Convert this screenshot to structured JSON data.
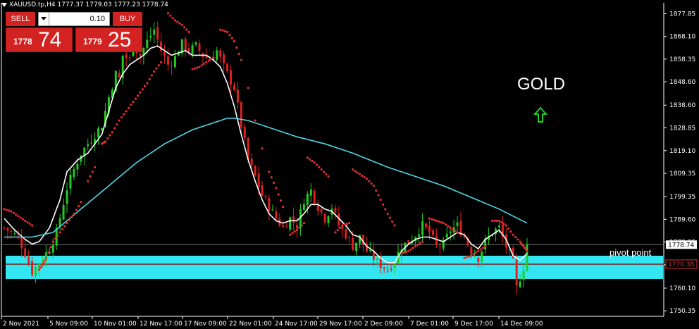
{
  "header": {
    "symbol_line": "XAUUSD.tp,H4  1777.37 1779.03 1777.23 1778.74"
  },
  "trade_panel": {
    "sell_label": "SELL",
    "buy_label": "BUY",
    "lot_value": "0.10",
    "sell_price_small": "1778",
    "sell_price_big": "74",
    "buy_price_small": "1779",
    "buy_price_big": "25"
  },
  "annotations": {
    "gold_label": "GOLD",
    "arrow_icon": "up-arrow-icon",
    "pivot_label": "pivot point"
  },
  "colors": {
    "background": "#000000",
    "bull_candle": "#22cc22",
    "bear_candle": "#dd2222",
    "ma_fast": "#ffffff",
    "ma_slow": "#4fd8e8",
    "sar": "#e03030",
    "pivot_zone": "#33e6f2",
    "panel_red": "#d32222",
    "gold_arrow": "#22cc22"
  },
  "chart_data": {
    "type": "candlestick",
    "timeframe": "H4",
    "y_ticks": [
      "1877.85",
      "1868.10",
      "1858.35",
      "1848.60",
      "1838.60",
      "1828.85",
      "1819.10",
      "1809.35",
      "1799.35",
      "1789.60",
      "1779.85",
      "1770.10",
      "1760.10",
      "1750.35"
    ],
    "ylim": [
      1748.0,
      1882.5
    ],
    "x_ticks": [
      "2 Nov 2021",
      "5 Nov 09:00",
      "10 Nov 01:00",
      "12 Nov 17:00",
      "17 Nov 09:00",
      "22 Nov 01:00",
      "24 Nov 17:00",
      "29 Nov 17:00",
      "2 Dec 09:00",
      "7 Dec 01:00",
      "9 Dec 17:00",
      "14 Dec 09:00"
    ],
    "current_price": "1778.74",
    "pivot_price": "1770.38",
    "pivot_zone": [
      1764.0,
      1774.0
    ],
    "close_path": [
      [
        0,
        1786
      ],
      [
        4,
        1782
      ],
      [
        6,
        1775
      ],
      [
        8,
        1767
      ],
      [
        10,
        1771
      ],
      [
        13,
        1777
      ],
      [
        15,
        1784
      ],
      [
        18,
        1803
      ],
      [
        20,
        1811
      ],
      [
        22,
        1818
      ],
      [
        24,
        1822
      ],
      [
        26,
        1826
      ],
      [
        28,
        1830
      ],
      [
        30,
        1842
      ],
      [
        32,
        1852
      ],
      [
        33,
        1850
      ],
      [
        34,
        1860
      ],
      [
        36,
        1858
      ],
      [
        37,
        1864
      ],
      [
        39,
        1860
      ],
      [
        41,
        1866
      ],
      [
        43,
        1871
      ],
      [
        45,
        1862
      ],
      [
        47,
        1856
      ],
      [
        49,
        1859
      ],
      [
        51,
        1865
      ],
      [
        53,
        1862
      ],
      [
        55,
        1864
      ],
      [
        57,
        1860
      ],
      [
        59,
        1858
      ],
      [
        61,
        1862
      ],
      [
        63,
        1855
      ],
      [
        66,
        1846
      ],
      [
        68,
        1830
      ],
      [
        70,
        1815
      ],
      [
        72,
        1808
      ],
      [
        74,
        1800
      ],
      [
        76,
        1795
      ],
      [
        78,
        1790
      ],
      [
        80,
        1786
      ],
      [
        82,
        1790
      ],
      [
        84,
        1787
      ],
      [
        86,
        1798
      ],
      [
        88,
        1802
      ],
      [
        90,
        1795
      ],
      [
        92,
        1790
      ],
      [
        94,
        1795
      ],
      [
        96,
        1787
      ],
      [
        98,
        1783
      ],
      [
        100,
        1778
      ],
      [
        102,
        1782
      ],
      [
        104,
        1776
      ],
      [
        106,
        1773
      ],
      [
        108,
        1770
      ],
      [
        110,
        1768
      ],
      [
        112,
        1772
      ],
      [
        114,
        1778
      ],
      [
        116,
        1780
      ],
      [
        118,
        1783
      ],
      [
        120,
        1787
      ],
      [
        122,
        1784
      ],
      [
        124,
        1778
      ],
      [
        126,
        1779
      ],
      [
        128,
        1785
      ],
      [
        130,
        1787
      ],
      [
        132,
        1782
      ],
      [
        134,
        1776
      ],
      [
        136,
        1773
      ],
      [
        138,
        1780
      ],
      [
        140,
        1784
      ],
      [
        142,
        1786
      ],
      [
        144,
        1778
      ],
      [
        146,
        1771
      ],
      [
        147,
        1760
      ],
      [
        149,
        1769
      ],
      [
        150,
        1779
      ]
    ],
    "series": [
      {
        "name": "",
        "kind": "ma_fast",
        "values": [
          [
            0,
            1790
          ],
          [
            3,
            1785
          ],
          [
            6,
            1781
          ],
          [
            8,
            1779
          ],
          [
            10,
            1780
          ],
          [
            13,
            1786
          ],
          [
            16,
            1798
          ],
          [
            18,
            1810
          ],
          [
            21,
            1815
          ],
          [
            24,
            1818
          ],
          [
            26,
            1822
          ],
          [
            28,
            1826
          ],
          [
            30,
            1836
          ],
          [
            32,
            1846
          ],
          [
            34,
            1852
          ],
          [
            36,
            1856
          ],
          [
            38,
            1858
          ],
          [
            40,
            1860
          ],
          [
            42,
            1863
          ],
          [
            44,
            1864
          ],
          [
            46,
            1862
          ],
          [
            48,
            1860
          ],
          [
            50,
            1861
          ],
          [
            52,
            1862
          ],
          [
            54,
            1860
          ],
          [
            56,
            1860
          ],
          [
            58,
            1860
          ],
          [
            60,
            1858
          ],
          [
            62,
            1855
          ],
          [
            64,
            1848
          ],
          [
            66,
            1838
          ],
          [
            68,
            1826
          ],
          [
            70,
            1815
          ],
          [
            72,
            1806
          ],
          [
            74,
            1798
          ],
          [
            76,
            1792
          ],
          [
            78,
            1789
          ],
          [
            80,
            1788
          ],
          [
            82,
            1789
          ],
          [
            84,
            1789
          ],
          [
            86,
            1792
          ],
          [
            88,
            1796
          ],
          [
            90,
            1796
          ],
          [
            92,
            1794
          ],
          [
            94,
            1793
          ],
          [
            96,
            1790
          ],
          [
            98,
            1787
          ],
          [
            100,
            1783
          ],
          [
            102,
            1782
          ],
          [
            104,
            1778
          ],
          [
            106,
            1776
          ],
          [
            108,
            1773
          ],
          [
            110,
            1771
          ],
          [
            112,
            1771
          ],
          [
            114,
            1776
          ],
          [
            116,
            1779
          ],
          [
            118,
            1781
          ],
          [
            120,
            1782
          ],
          [
            122,
            1782
          ],
          [
            124,
            1781
          ],
          [
            126,
            1780
          ],
          [
            128,
            1782
          ],
          [
            130,
            1784
          ],
          [
            132,
            1783
          ],
          [
            134,
            1779
          ],
          [
            136,
            1777
          ],
          [
            138,
            1781
          ],
          [
            140,
            1783
          ],
          [
            142,
            1785
          ],
          [
            144,
            1781
          ],
          [
            146,
            1774
          ],
          [
            148,
            1772
          ],
          [
            150,
            1775
          ]
        ]
      },
      {
        "name": "",
        "kind": "ma_slow",
        "values": [
          [
            0,
            1782
          ],
          [
            8,
            1782
          ],
          [
            14,
            1784
          ],
          [
            22,
            1794
          ],
          [
            30,
            1804
          ],
          [
            38,
            1814
          ],
          [
            46,
            1822
          ],
          [
            54,
            1828
          ],
          [
            60,
            1831
          ],
          [
            64,
            1833
          ],
          [
            66,
            1833
          ],
          [
            70,
            1832
          ],
          [
            76,
            1829
          ],
          [
            84,
            1825
          ],
          [
            92,
            1822
          ],
          [
            100,
            1818
          ],
          [
            110,
            1812
          ],
          [
            118,
            1808
          ],
          [
            126,
            1804
          ],
          [
            134,
            1799
          ],
          [
            142,
            1794
          ],
          [
            150,
            1788
          ]
        ]
      },
      {
        "name": "",
        "kind": "sar",
        "values": [
          [
            0,
            1794
          ],
          [
            2,
            1793
          ],
          [
            4,
            1791
          ],
          [
            6,
            1789
          ],
          [
            8,
            1787
          ],
          [
            10,
            1768
          ],
          [
            11,
            1770
          ],
          [
            12,
            1773
          ],
          [
            14,
            1780
          ],
          [
            16,
            1784
          ],
          [
            18,
            1788
          ],
          [
            20,
            1792
          ],
          [
            22,
            1797
          ],
          [
            24,
            1806
          ],
          [
            26,
            1812
          ],
          [
            28,
            1822
          ],
          [
            29,
            1823
          ],
          [
            31,
            1827
          ],
          [
            33,
            1832
          ],
          [
            35,
            1836
          ],
          [
            37,
            1840
          ],
          [
            39,
            1844
          ],
          [
            41,
            1848
          ],
          [
            43,
            1853
          ],
          [
            45,
            1857
          ],
          [
            47,
            1878
          ],
          [
            49,
            1875
          ],
          [
            51,
            1873
          ],
          [
            53,
            1870
          ],
          [
            54,
            1854
          ],
          [
            56,
            1855
          ],
          [
            58,
            1857
          ],
          [
            60,
            1859
          ],
          [
            62,
            1871
          ],
          [
            64,
            1870
          ],
          [
            66,
            1866
          ],
          [
            68,
            1858
          ],
          [
            70,
            1846
          ],
          [
            72,
            1832
          ],
          [
            74,
            1820
          ],
          [
            76,
            1810
          ],
          [
            78,
            1803
          ],
          [
            80,
            1795
          ],
          [
            82,
            1783
          ],
          [
            84,
            1785
          ],
          [
            86,
            1788
          ],
          [
            87,
            1816
          ],
          [
            89,
            1814
          ],
          [
            91,
            1811
          ],
          [
            93,
            1808
          ],
          [
            95,
            1784
          ],
          [
            97,
            1787
          ],
          [
            99,
            1788
          ],
          [
            100,
            1811
          ],
          [
            102,
            1809
          ],
          [
            104,
            1807
          ],
          [
            106,
            1804
          ],
          [
            108,
            1798
          ],
          [
            110,
            1792
          ],
          [
            112,
            1787
          ],
          [
            114,
            1775
          ],
          [
            116,
            1776
          ],
          [
            118,
            1778
          ],
          [
            120,
            1780
          ],
          [
            122,
            1790
          ],
          [
            124,
            1789
          ],
          [
            126,
            1788
          ],
          [
            128,
            1786
          ],
          [
            130,
            1784
          ],
          [
            132,
            1773
          ],
          [
            134,
            1774
          ],
          [
            136,
            1776
          ],
          [
            138,
            1778
          ],
          [
            140,
            1789
          ],
          [
            142,
            1789
          ],
          [
            144,
            1787
          ],
          [
            146,
            1783
          ],
          [
            148,
            1780
          ],
          [
            149,
            1778
          ],
          [
            150,
            1776
          ]
        ]
      }
    ]
  }
}
